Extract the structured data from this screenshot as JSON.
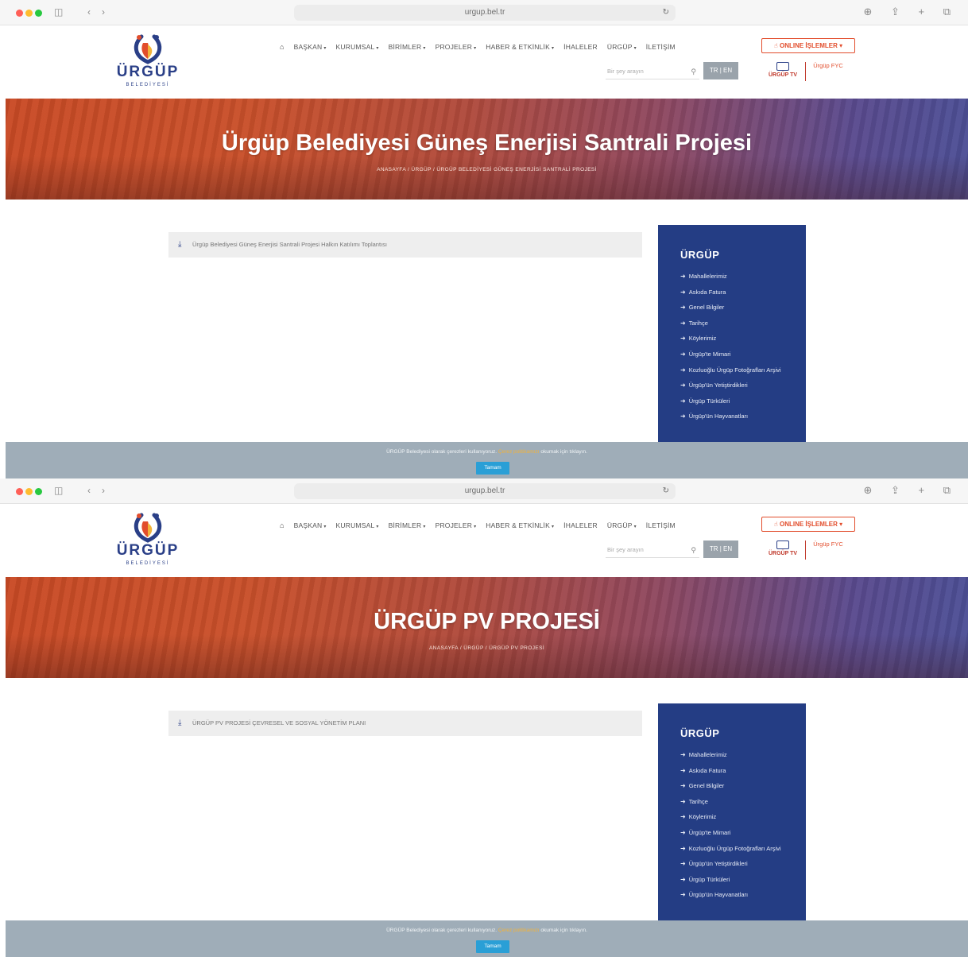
{
  "browser": {
    "address": "urgup.bel.tr",
    "sidebar_glyph": "◫",
    "back_glyph": "‹",
    "forward_glyph": "›",
    "reload_glyph": "↻",
    "right_glyphs": "⊕ ⇪ + ⧉"
  },
  "header": {
    "logo_text": "ÜRGÜP",
    "logo_sub": "BELEDİYESİ",
    "nav": [
      {
        "label": "BAŞKAN",
        "caret": "▾"
      },
      {
        "label": "KURUMSAL",
        "caret": "▾"
      },
      {
        "label": "BİRİMLER",
        "caret": "▾"
      },
      {
        "label": "PROJELER",
        "caret": "▾"
      },
      {
        "label": "HABER & ETKİNLİK",
        "caret": "▾"
      },
      {
        "label": "İHALELER",
        "caret": ""
      },
      {
        "label": "ÜRGÜP",
        "caret": "▾"
      },
      {
        "label": "İLETİŞİM",
        "caret": ""
      }
    ],
    "home_icon": "⌂",
    "online_button": "ONLINE İŞLEMLER ▾",
    "online_icon": "☝",
    "search_placeholder": "Bir şey arayın",
    "search_icon": "⚲",
    "lang": "TR | EN",
    "tv_label": "ÜRGÜP TV",
    "fyc_label": "Ürgüp FYC"
  },
  "pages": [
    {
      "hero_title": "Ürgüp Belediyesi Güneş Enerjisi Santrali Projesi",
      "breadcrumb": "ANASAYFA / ÜRGÜP / ÜRGÜP BELEDİYESİ GÜNEŞ ENERJİSİ SANTRALİ PROJESİ",
      "document": "Ürgüp Belediyesi Güneş Enerjisi Santrali Projesi Halkın Katılımı Toplantısı"
    },
    {
      "hero_title": "ÜRGÜP PV PROJESİ",
      "breadcrumb": "ANASAYFA / ÜRGÜP / ÜRGÜP PV PROJESİ",
      "document": "ÜRGÜP PV PROJESİ ÇEVRESEL VE SOSYAL YÖNETİM PLANI"
    }
  ],
  "sidebar": {
    "title": "ÜRGÜP",
    "arrow": "➜",
    "items": [
      "Mahallelerimiz",
      "Askıda Fatura",
      "Genel Bilgiler",
      "Tarihçe",
      "Köylerimiz",
      "Ürgüp'te Mimari",
      "Kozluoğlu Ürgüp Fotoğrafları Arşivi",
      "Ürgüp'ün Yetiştirdikleri",
      "Ürgüp Türküleri",
      "Ürgüp'ün Hayvanatları"
    ]
  },
  "cookie": {
    "text_before": "ÜRGÜP Belediyesi olarak çerezleri kullanıyoruz.",
    "link": "Çerez politikamızı",
    "text_after": " okumak için tıklayın.",
    "button": "Tamam"
  },
  "colors": {
    "brand_blue": "#243d84",
    "accent_orange": "#e24d2c",
    "cookie_bg": "#9fadb8",
    "cookie_button": "#2a9fd6"
  }
}
